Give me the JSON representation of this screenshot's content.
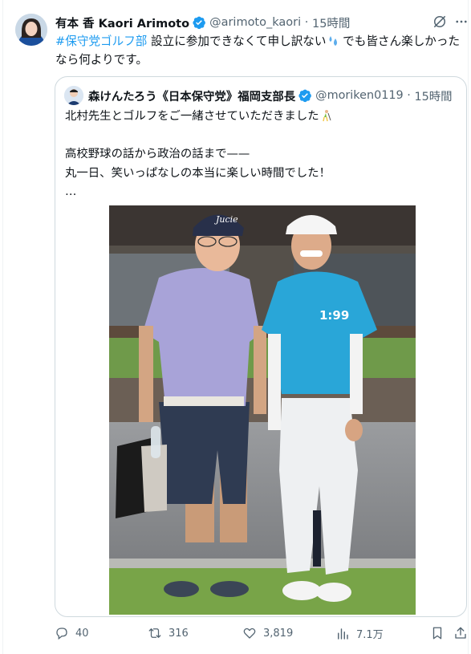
{
  "author": {
    "name": "有本 香 Kaori Arimoto",
    "handle": "@arimoto_kaori",
    "time": "15時間"
  },
  "tweet": {
    "hashtag": "#保守党ゴルフ部",
    "text_part1": " 設立に参加できなくて申し訳ない",
    "text_part2": " でも皆さん楽しかったなら何よりです。"
  },
  "quote": {
    "name": "森けんたろう《日本保守党》福岡支部長",
    "handle": "@moriken0119",
    "time": "15時間",
    "line1": "北村先生とゴルフをご一緒させていただきました",
    "body": "高校野球の話から政治の話まで——\n丸一日、笑いっぱなしの本当に楽しい時間でした！\n…"
  },
  "photo": {
    "cap_text": "Jucie",
    "shirt_number": "1:99"
  },
  "actions": {
    "replies": "40",
    "reposts": "316",
    "likes": "3,819",
    "views": "7.1万"
  },
  "colors": {
    "accent": "#1d9bf0",
    "verified": "#1d9bf0",
    "muted": "#536471"
  },
  "icons": [
    "verified-badge-icon",
    "grok-icon",
    "more-icon",
    "golfer-emoji-icon",
    "sweat-emoji-icon",
    "reply-icon",
    "repost-icon",
    "like-icon",
    "views-icon",
    "bookmark-icon",
    "share-icon"
  ]
}
